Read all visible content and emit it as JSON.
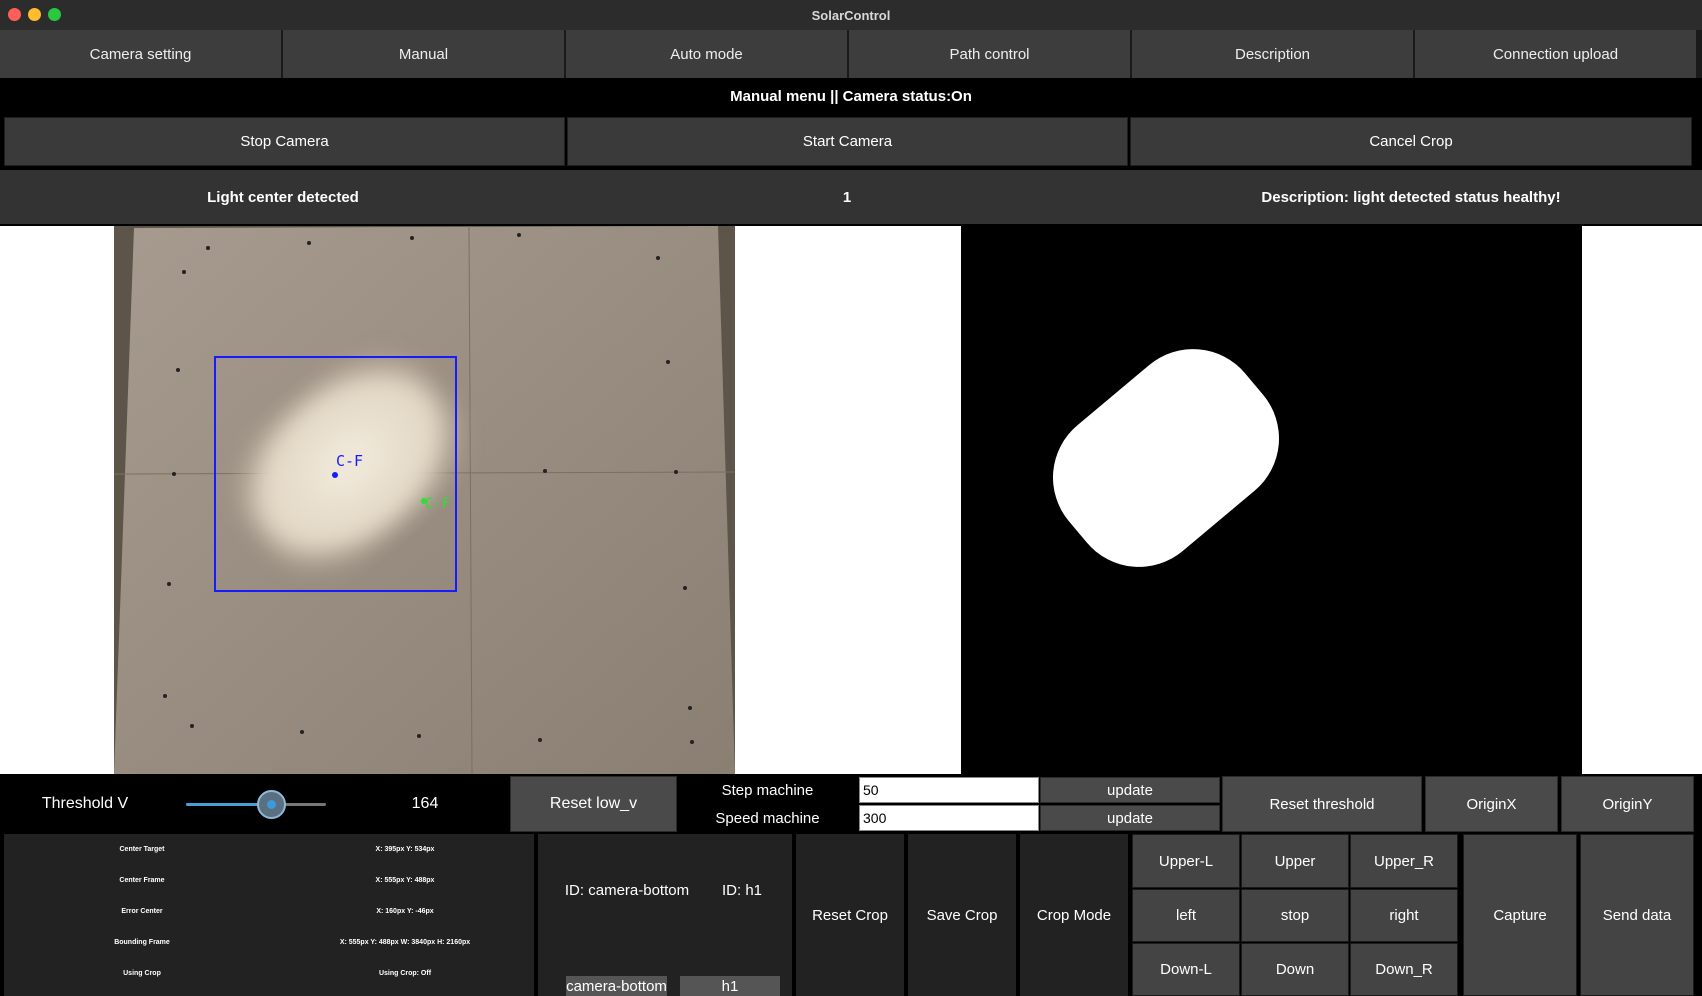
{
  "window": {
    "title": "SolarControl"
  },
  "nav": {
    "tabs": [
      "Camera setting",
      "Manual",
      "Auto mode",
      "Path control",
      "Description",
      "Connection upload"
    ]
  },
  "status": "Manual menu || Camera status:On",
  "camera_buttons": {
    "stop": "Stop Camera",
    "start": "Start Camera",
    "cancel_crop": "Cancel Crop"
  },
  "info": {
    "left": "Light center detected",
    "count": "1",
    "description": "Description: light detected status healthy!"
  },
  "overlay": {
    "center_label": "C-F",
    "frame_label": "C-F"
  },
  "controls": {
    "threshold_label": "Threshold V",
    "threshold_value": "164",
    "threshold_fraction": 0.64,
    "reset_low": "Reset low_v",
    "step_label": "Step machine",
    "speed_label": "Speed machine",
    "step_value": "50",
    "speed_value": "300",
    "update": "update",
    "reset_threshold": "Reset threshold",
    "originx": "OriginX",
    "originy": "OriginY"
  },
  "readouts": [
    {
      "label": "Center Target",
      "value": "X: 395px Y: 534px"
    },
    {
      "label": "Center Frame",
      "value": "X: 555px Y: 488px"
    },
    {
      "label": "Error Center",
      "value": "X: 160px Y: -46px"
    },
    {
      "label": "Bounding Frame",
      "value": "X: 555px Y: 488px W: 3840px H: 2160px"
    },
    {
      "label": "Using Crop",
      "value": "Using Crop: Off"
    }
  ],
  "ids": {
    "camera_id": "ID: camera-bottom",
    "h_id": "ID: h1",
    "camera_value": "camera-bottom",
    "h_value": "h1"
  },
  "crop": {
    "reset": "Reset Crop",
    "save": "Save Crop",
    "mode": "Crop Mode"
  },
  "pad": {
    "upper_l": "Upper-L",
    "upper": "Upper",
    "upper_r": "Upper_R",
    "left": "left",
    "stop": "stop",
    "right": "right",
    "down_l": "Down-L",
    "down": "Down",
    "down_r": "Down_R"
  },
  "actions": {
    "capture": "Capture",
    "send": "Send data"
  },
  "colors": {
    "bbox": "#1a1aff",
    "frame_marker": "#33dd33"
  }
}
